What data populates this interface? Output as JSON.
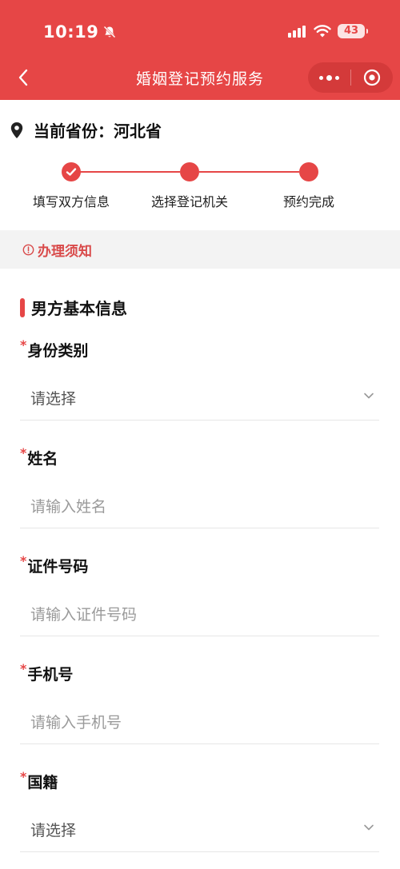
{
  "status_bar": {
    "time": "10:19",
    "battery": "43"
  },
  "nav": {
    "title": "婚姻登记预约服务"
  },
  "province": {
    "label": "当前省份：河北省"
  },
  "steps": [
    {
      "label": "填写双方信息",
      "completed": true
    },
    {
      "label": "选择登记机关",
      "completed": false
    },
    {
      "label": "预约完成",
      "completed": false
    }
  ],
  "notice": {
    "text": "办理须知"
  },
  "section": {
    "title": "男方基本信息"
  },
  "fields": [
    {
      "label": "身份类别",
      "value": "请选择",
      "kind": "select"
    },
    {
      "label": "姓名",
      "value": "请输入姓名",
      "kind": "input"
    },
    {
      "label": "证件号码",
      "value": "请输入证件号码",
      "kind": "input"
    },
    {
      "label": "手机号",
      "value": "请输入手机号",
      "kind": "input"
    },
    {
      "label": "国籍",
      "value": "请选择",
      "kind": "select"
    }
  ],
  "required_mark": "*",
  "colors": {
    "brand": "#e64646",
    "notice_text": "#d94a4a",
    "notice_bg": "#f3f3f3"
  }
}
